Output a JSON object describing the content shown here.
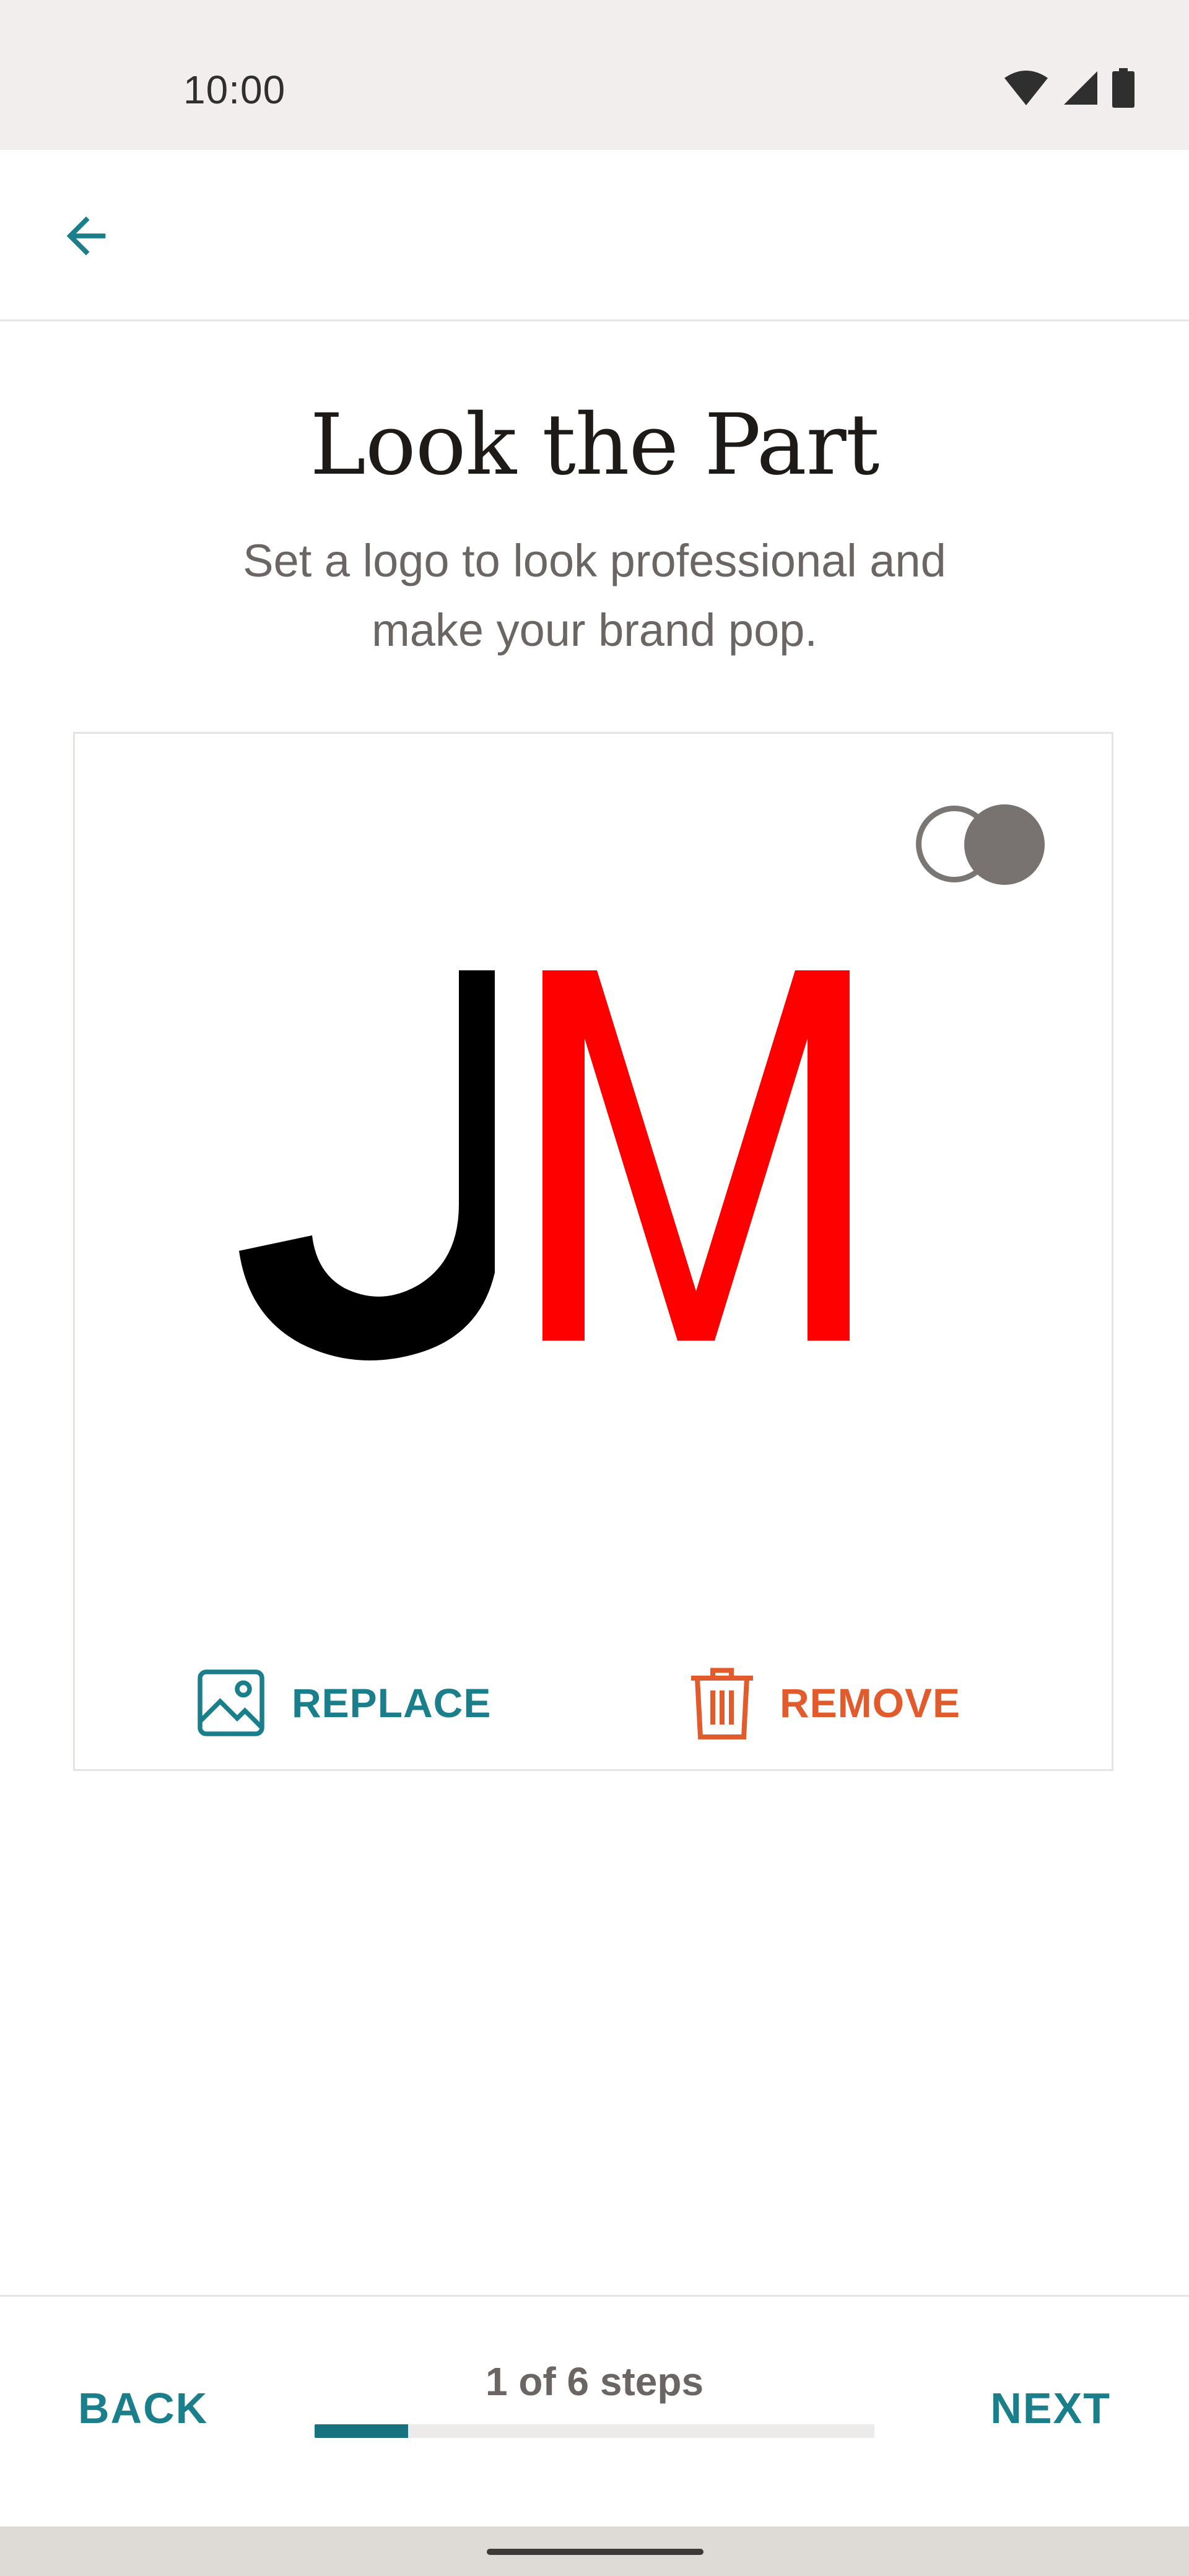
{
  "status_bar": {
    "time": "10:00",
    "icons": [
      "wifi-icon",
      "cell-signal-icon",
      "battery-icon"
    ]
  },
  "header": {
    "back_icon": "arrow-left-icon"
  },
  "page": {
    "title": "Look the Part",
    "subtitle": "Set a logo to look professional and make your brand pop."
  },
  "logo_card": {
    "toggle_state": "on",
    "logo_text": "JM",
    "logo_colors": {
      "J": "#000000",
      "M": "#ff0000"
    },
    "replace_label": "REPLACE",
    "replace_icon": "image-icon",
    "remove_label": "REMOVE",
    "remove_icon": "trash-icon"
  },
  "footer": {
    "back_label": "BACK",
    "next_label": "NEXT",
    "steps_label": "1 of 6 steps",
    "progress_fraction": 0.1667
  },
  "colors": {
    "accent": "#1a7f8b",
    "danger": "#e25b2c",
    "progress": "#16727f"
  }
}
